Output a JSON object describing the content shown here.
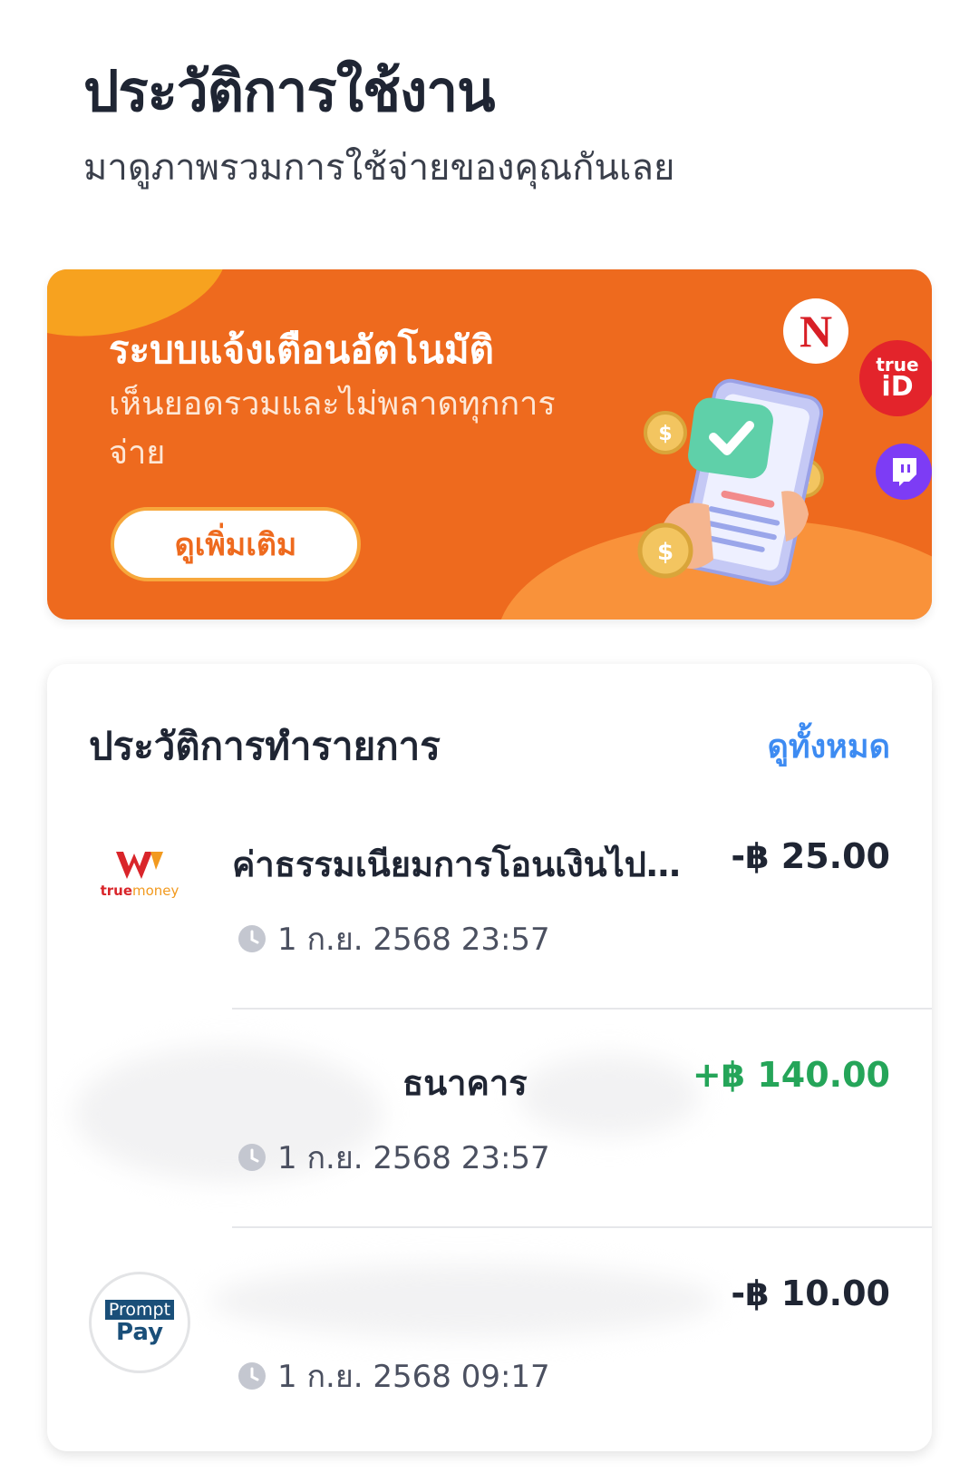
{
  "header": {
    "title": "ประวัติการใช้งาน",
    "subtitle": "มาดูภาพรวมการใช้จ่ายของคุณกันเลย"
  },
  "banner": {
    "title": "ระบบแจ้งเตือนอัตโนมัติ",
    "description": "เห็นยอดรวมและไม่พลาดทุกการจ่าย",
    "button_label": "ดูเพิ่มเติม",
    "logos": {
      "netflix": "N",
      "trueid_top": "true",
      "trueid_bottom": "iD"
    },
    "colors": {
      "background": "#ee6a1e",
      "accent": "#f7a21f"
    }
  },
  "transactions": {
    "title": "ประวัติการทำรายการ",
    "see_all_label": "ดูทั้งหมด",
    "items": [
      {
        "name": "ค่าธรรมเนียมการโอนเงินไปบั...",
        "amount": "-฿ 25.00",
        "time": "1 ก.ย. 2568 23:57",
        "logo_main": "W",
        "logo_brand_a": "true",
        "logo_brand_b": "money",
        "icon": "truemoney-logo"
      },
      {
        "name": "ธนาคาร",
        "amount": "+฿ 140.00",
        "time": "1 ก.ย. 2568 23:57",
        "icon": "bank-logo"
      },
      {
        "name": "",
        "amount": "-฿ 10.00",
        "time": "1 ก.ย. 2568 09:17",
        "logo_top": "Prompt",
        "logo_bottom": "Pay",
        "icon": "promptpay-logo"
      }
    ],
    "colors": {
      "positive": "#25a559",
      "link": "#3d8bf2"
    }
  }
}
